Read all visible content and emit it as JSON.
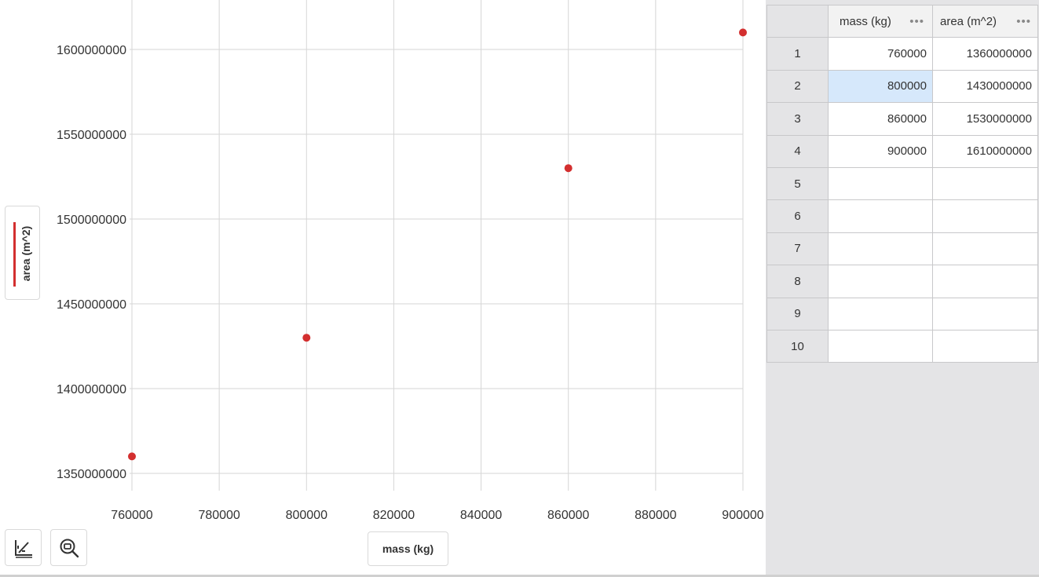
{
  "chart_data": {
    "type": "scatter",
    "title": "",
    "xlabel": "mass (kg)",
    "ylabel": "area (m^2)",
    "xlim": [
      758000,
      905500
    ],
    "ylim": [
      1335000,
      1628000
    ],
    "x_ticks": [
      "760000",
      "780000",
      "800000",
      "820000",
      "840000",
      "860000",
      "880000",
      "900000"
    ],
    "y_ticks": [
      "1350000000",
      "1400000000",
      "1450000000",
      "1500000000",
      "1550000000",
      "1600000000"
    ],
    "x_tick_values": [
      760000,
      780000,
      800000,
      820000,
      840000,
      860000,
      880000,
      900000
    ],
    "y_tick_values": [
      1350000000,
      1400000000,
      1450000000,
      1500000000,
      1550000000,
      1600000000
    ],
    "grid": true,
    "series": [
      {
        "name": "area (m^2)",
        "color": "#d32f2f",
        "points": [
          {
            "x": 760000,
            "y": 1360000000
          },
          {
            "x": 800000,
            "y": 1430000000
          },
          {
            "x": 860000,
            "y": 1530000000
          },
          {
            "x": 900000,
            "y": 1610000000
          }
        ]
      }
    ]
  },
  "y_axis_chip": {
    "label": "area (m^2)",
    "color": "#d32f2f"
  },
  "x_axis_chip": {
    "label": "mass (kg)"
  },
  "toolbar": {
    "graph_icon": "graph-axes-icon",
    "zoom_icon": "zoom-fit-icon"
  },
  "table": {
    "columns": [
      {
        "label": "mass (kg)",
        "menu": "•••"
      },
      {
        "label": "area (m^2)",
        "menu": "•••"
      }
    ],
    "rows": [
      {
        "index": "1",
        "cells": [
          "760000",
          "1360000000"
        ]
      },
      {
        "index": "2",
        "cells": [
          "800000",
          "1430000000"
        ]
      },
      {
        "index": "3",
        "cells": [
          "860000",
          "1530000000"
        ]
      },
      {
        "index": "4",
        "cells": [
          "900000",
          "1610000000"
        ]
      },
      {
        "index": "5",
        "cells": [
          "",
          ""
        ]
      },
      {
        "index": "6",
        "cells": [
          "",
          ""
        ]
      },
      {
        "index": "7",
        "cells": [
          "",
          ""
        ]
      },
      {
        "index": "8",
        "cells": [
          "",
          ""
        ]
      },
      {
        "index": "9",
        "cells": [
          "",
          ""
        ]
      },
      {
        "index": "10",
        "cells": [
          "",
          ""
        ]
      }
    ],
    "selected_cell": {
      "row": 2,
      "col": 1
    }
  }
}
